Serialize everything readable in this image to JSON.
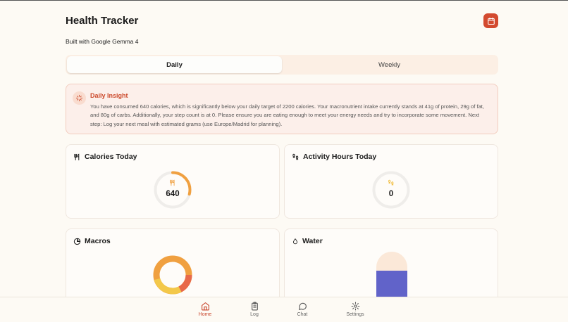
{
  "app": {
    "title": "Health Tracker",
    "subtitle": "Built with Google Gemma 4",
    "accent_color": "#d34a2f"
  },
  "tabs": [
    {
      "label": "Daily",
      "active": true
    },
    {
      "label": "Weekly",
      "active": false
    }
  ],
  "insight": {
    "title": "Daily Insight",
    "icon": "sparkle-icon",
    "body": "You have consumed 640 calories, which is significantly below your daily target of 2200 calories. Your macronutrient intake currently stands at 41g of protein, 29g of fat, and 80g of carbs. Additionally, your step count is at 0. Please ensure you are eating enough to meet your energy needs and try to incorporate some movement. Next step: Log your next meal with estimated grams (use Europe/Madrid for planning)."
  },
  "cards": {
    "calories": {
      "title": "Calories Today",
      "icon": "utensils-icon",
      "value": "640",
      "progress_fraction": 0.29
    },
    "activity": {
      "title": "Activity Hours Today",
      "icon": "footprints-icon",
      "value": "0",
      "progress_fraction": 0
    },
    "macros": {
      "title": "Macros",
      "icon": "pie-chart-icon"
    },
    "water": {
      "title": "Water",
      "icon": "droplet-icon",
      "fill_fraction": 0.65
    }
  },
  "nav": [
    {
      "label": "Home",
      "icon": "home-icon",
      "active": true
    },
    {
      "label": "Log",
      "icon": "clipboard-icon",
      "active": false
    },
    {
      "label": "Chat",
      "icon": "chat-bubble-icon",
      "active": false
    },
    {
      "label": "Settings",
      "icon": "gear-icon",
      "active": false
    }
  ]
}
